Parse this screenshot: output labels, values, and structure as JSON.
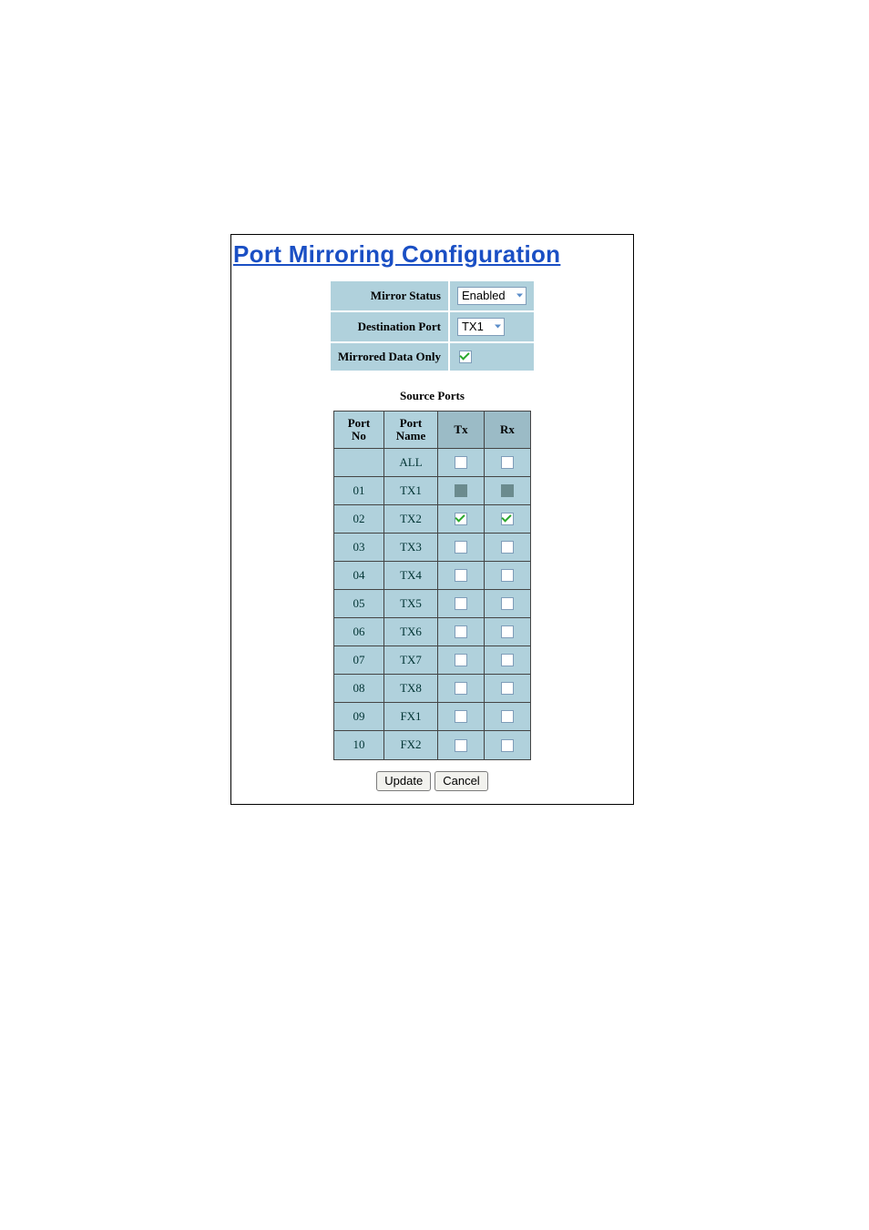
{
  "title": "Port Mirroring Configuration",
  "settings": {
    "mirror_status_label": "Mirror Status",
    "mirror_status_value": "Enabled",
    "destination_port_label": "Destination Port",
    "destination_port_value": "TX1",
    "mirrored_data_only_label": "Mirrored Data Only",
    "mirrored_data_only_checked": true
  },
  "source": {
    "heading": "Source Ports",
    "headers": {
      "portno": "Port\nNo",
      "portname": "Port\nName",
      "tx": "Tx",
      "rx": "Rx"
    },
    "rows": [
      {
        "no": "",
        "name": "ALL",
        "tx": false,
        "rx": false,
        "txDisabled": false,
        "rxDisabled": false
      },
      {
        "no": "01",
        "name": "TX1",
        "tx": false,
        "rx": false,
        "txDisabled": true,
        "rxDisabled": true
      },
      {
        "no": "02",
        "name": "TX2",
        "tx": true,
        "rx": true,
        "txDisabled": false,
        "rxDisabled": false
      },
      {
        "no": "03",
        "name": "TX3",
        "tx": false,
        "rx": false,
        "txDisabled": false,
        "rxDisabled": false
      },
      {
        "no": "04",
        "name": "TX4",
        "tx": false,
        "rx": false,
        "txDisabled": false,
        "rxDisabled": false
      },
      {
        "no": "05",
        "name": "TX5",
        "tx": false,
        "rx": false,
        "txDisabled": false,
        "rxDisabled": false
      },
      {
        "no": "06",
        "name": "TX6",
        "tx": false,
        "rx": false,
        "txDisabled": false,
        "rxDisabled": false
      },
      {
        "no": "07",
        "name": "TX7",
        "tx": false,
        "rx": false,
        "txDisabled": false,
        "rxDisabled": false
      },
      {
        "no": "08",
        "name": "TX8",
        "tx": false,
        "rx": false,
        "txDisabled": false,
        "rxDisabled": false
      },
      {
        "no": "09",
        "name": "FX1",
        "tx": false,
        "rx": false,
        "txDisabled": false,
        "rxDisabled": false
      },
      {
        "no": "10",
        "name": "FX2",
        "tx": false,
        "rx": false,
        "txDisabled": false,
        "rxDisabled": false
      }
    ]
  },
  "buttons": {
    "update": "Update",
    "cancel": "Cancel"
  },
  "colors": {
    "accent": "#B0D1DC",
    "accent_dark": "#9BBBC6",
    "link_blue": "#1A4FC4"
  }
}
